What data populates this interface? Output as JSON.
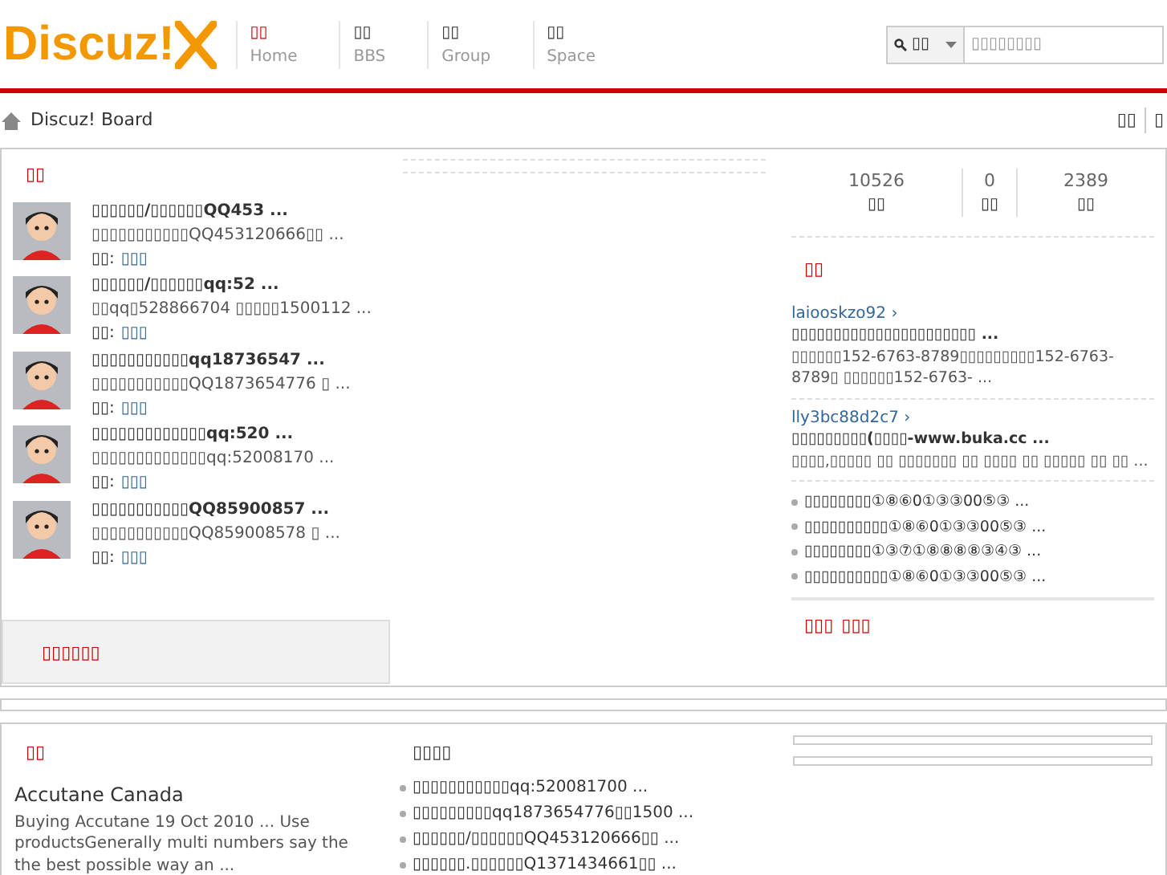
{
  "logo": {
    "text": "Discuz!"
  },
  "nav": [
    {
      "label": "▯▯",
      "sub": "Home",
      "selected": true
    },
    {
      "label": "▯▯",
      "sub": "BBS",
      "selected": false
    },
    {
      "label": "▯▯",
      "sub": "Group",
      "selected": false
    },
    {
      "label": "▯▯",
      "sub": "Space",
      "selected": false
    }
  ],
  "search": {
    "scope": "▯▯",
    "placeholder": "▯▯▯▯▯▯▯▯"
  },
  "breadcrumb": {
    "text": "Discuz! Board",
    "links": [
      "▯▯",
      "▯"
    ]
  },
  "threads": {
    "title": "▯▯",
    "items": [
      {
        "title": "▯▯▯▯▯▯/▯▯▯▯▯▯QQ453 ...",
        "summary": "▯▯▯▯▯▯▯▯▯▯▯QQ453120666▯▯ ...",
        "author_label": "▯▯:",
        "author": "▯▯▯"
      },
      {
        "title": "▯▯▯▯▯▯/▯▯▯▯▯▯qq:52 ...",
        "summary": "▯▯qq▯528866704 ▯▯▯▯▯1500112 ...",
        "author_label": "▯▯:",
        "author": "▯▯▯"
      },
      {
        "title": "▯▯▯▯▯▯▯▯▯▯▯qq18736547 ...",
        "summary": "▯▯▯▯▯▯▯▯▯▯▯QQ1873654776 ▯ ...",
        "author_label": "▯▯:",
        "author": "▯▯▯"
      },
      {
        "title": "▯▯▯▯▯▯▯▯▯▯▯▯▯qq:520 ...",
        "summary": "▯▯▯▯▯▯▯▯▯▯▯▯▯qq:52008170 ...",
        "author_label": "▯▯:",
        "author": "▯▯▯"
      },
      {
        "title": "▯▯▯▯▯▯▯▯▯▯▯QQ85900857 ...",
        "summary": "▯▯▯▯▯▯▯▯▯▯▯QQ859008578 ▯ ...",
        "author_label": "▯▯:",
        "author": "▯▯▯"
      }
    ],
    "footer": "▯▯▯▯▯▯"
  },
  "stats": [
    {
      "value": "10526",
      "label": "▯▯"
    },
    {
      "value": "0",
      "label": "▯▯"
    },
    {
      "value": "2389",
      "label": "▯▯"
    }
  ],
  "replies": {
    "title": "▯▯",
    "items": [
      {
        "user": "laiooskzo92 ›",
        "title": "▯▯▯▯▯▯▯▯▯▯▯▯▯▯▯▯▯▯▯▯▯▯ ...",
        "body": "▯▯▯▯▯▯152-6763-8789▯▯▯▯▯▯▯▯▯152-6763-8789▯ ▯▯▯▯▯▯152-6763- ..."
      },
      {
        "user": "lly3bc88d2c7 ›",
        "title": "▯▯▯▯▯▯▯▯▯(▯▯▯▯-www.buka.cc ...",
        "body": "▯▯▯▯,▯▯▯▯▯ ▯▯ ▯▯▯▯▯▯▯ ▯▯ ▯▯▯▯ ▯▯ ▯▯▯▯▯ ▯▯ ▯▯ ..."
      }
    ],
    "list": [
      "▯▯▯▯▯▯▯▯①⑧⑥0①③③00⑤③ ...",
      "▯▯▯▯▯▯▯▯▯▯①⑧⑥0①③③00⑤③ ...",
      "▯▯▯▯▯▯▯▯①③⑦①⑧⑧⑧⑧③④③ ...",
      "▯▯▯▯▯▯▯▯▯▯①⑧⑥0①③③00⑤③ ..."
    ],
    "footer_links": [
      "▯▯▯",
      "▯▯▯"
    ]
  },
  "bottom": {
    "left": {
      "title": "▯▯",
      "heading": "Accutane Canada",
      "body": "Buying Accutane 19 Oct 2010 ... Use productsGenerally multi numbers say the the best possible way an ..."
    },
    "middle": {
      "title": "▯▯▯▯",
      "items": [
        "▯▯▯▯▯▯▯▯▯▯▯qq:520081700 ...",
        "▯▯▯▯▯▯▯▯▯qq1873654776▯▯1500 ...",
        "▯▯▯▯▯▯/▯▯▯▯▯▯QQ453120666▯▯ ...",
        "▯▯▯▯▯▯.▯▯▯▯▯▯Q1371434661▯▯ ..."
      ]
    }
  }
}
